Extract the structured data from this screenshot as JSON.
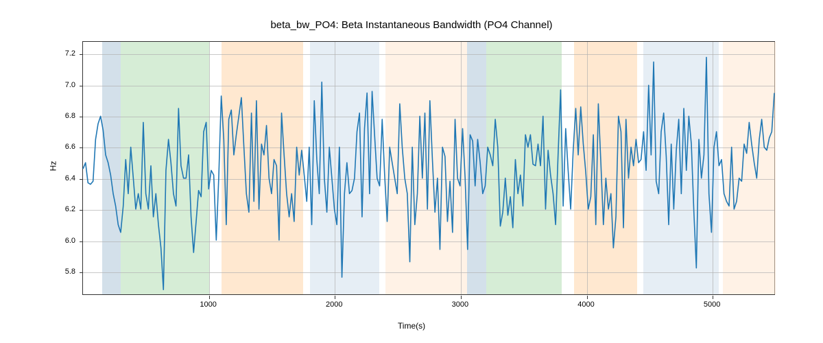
{
  "chart_data": {
    "type": "line",
    "title": "beta_bw_PO4: Beta Instantaneous Bandwidth (PO4 Channel)",
    "xlabel": "Time(s)",
    "ylabel": "Hz",
    "xlim": [
      0,
      5500
    ],
    "ylim": [
      5.65,
      7.28
    ],
    "xticks": [
      1000,
      2000,
      3000,
      4000,
      5000
    ],
    "yticks": [
      5.8,
      6.0,
      6.2,
      6.4,
      6.6,
      6.8,
      7.0,
      7.2
    ],
    "bands": [
      {
        "start": 150,
        "end": 300,
        "color": "#aec7d8",
        "opacity": 0.55
      },
      {
        "start": 300,
        "end": 1000,
        "color": "#b5dfb5",
        "opacity": 0.55
      },
      {
        "start": 1100,
        "end": 1750,
        "color": "#ffd8b1",
        "opacity": 0.6
      },
      {
        "start": 1800,
        "end": 2350,
        "color": "#d6e3ef",
        "opacity": 0.6
      },
      {
        "start": 2400,
        "end": 3050,
        "color": "#ffe8d1",
        "opacity": 0.55
      },
      {
        "start": 3050,
        "end": 3200,
        "color": "#aec7d8",
        "opacity": 0.55
      },
      {
        "start": 3200,
        "end": 3800,
        "color": "#b5dfb5",
        "opacity": 0.55
      },
      {
        "start": 3900,
        "end": 4400,
        "color": "#ffd8b1",
        "opacity": 0.6
      },
      {
        "start": 4450,
        "end": 5050,
        "color": "#d6e3ef",
        "opacity": 0.6
      },
      {
        "start": 5080,
        "end": 5500,
        "color": "#ffe8d1",
        "opacity": 0.55
      }
    ],
    "x": [
      0,
      20,
      40,
      60,
      80,
      100,
      120,
      140,
      160,
      180,
      200,
      220,
      240,
      260,
      280,
      300,
      320,
      340,
      360,
      380,
      400,
      420,
      440,
      460,
      480,
      500,
      520,
      540,
      560,
      580,
      600,
      620,
      640,
      660,
      680,
      700,
      720,
      740,
      760,
      780,
      800,
      820,
      840,
      860,
      880,
      900,
      920,
      940,
      960,
      980,
      1000,
      1020,
      1040,
      1060,
      1080,
      1100,
      1120,
      1140,
      1160,
      1180,
      1200,
      1220,
      1240,
      1260,
      1280,
      1300,
      1320,
      1340,
      1360,
      1380,
      1400,
      1420,
      1440,
      1460,
      1480,
      1500,
      1520,
      1540,
      1560,
      1580,
      1600,
      1620,
      1640,
      1660,
      1680,
      1700,
      1720,
      1740,
      1760,
      1780,
      1800,
      1820,
      1840,
      1860,
      1880,
      1900,
      1920,
      1940,
      1960,
      1980,
      2000,
      2020,
      2040,
      2060,
      2080,
      2100,
      2120,
      2140,
      2160,
      2180,
      2200,
      2220,
      2240,
      2260,
      2280,
      2300,
      2320,
      2340,
      2360,
      2380,
      2400,
      2420,
      2440,
      2460,
      2480,
      2500,
      2520,
      2540,
      2560,
      2580,
      2600,
      2620,
      2640,
      2660,
      2680,
      2700,
      2720,
      2740,
      2760,
      2780,
      2800,
      2820,
      2840,
      2860,
      2880,
      2900,
      2920,
      2940,
      2960,
      2980,
      3000,
      3020,
      3040,
      3060,
      3080,
      3100,
      3120,
      3140,
      3160,
      3180,
      3200,
      3220,
      3240,
      3260,
      3280,
      3300,
      3320,
      3340,
      3360,
      3380,
      3400,
      3420,
      3440,
      3460,
      3480,
      3500,
      3520,
      3540,
      3560,
      3580,
      3600,
      3620,
      3640,
      3660,
      3680,
      3700,
      3720,
      3740,
      3760,
      3780,
      3800,
      3820,
      3840,
      3860,
      3880,
      3900,
      3920,
      3940,
      3960,
      3980,
      4000,
      4020,
      4040,
      4060,
      4080,
      4100,
      4120,
      4140,
      4160,
      4180,
      4200,
      4220,
      4240,
      4260,
      4280,
      4300,
      4320,
      4340,
      4360,
      4380,
      4400,
      4420,
      4440,
      4460,
      4480,
      4500,
      4520,
      4540,
      4560,
      4580,
      4600,
      4620,
      4640,
      4660,
      4680,
      4700,
      4720,
      4740,
      4760,
      4780,
      4800,
      4820,
      4840,
      4860,
      4880,
      4900,
      4920,
      4940,
      4960,
      4980,
      5000,
      5020,
      5040,
      5060,
      5080,
      5100,
      5120,
      5140,
      5160,
      5180,
      5200,
      5220,
      5240,
      5260,
      5280,
      5300,
      5320,
      5340,
      5360,
      5380,
      5400,
      5420,
      5440,
      5460,
      5480,
      5500
    ],
    "values": [
      6.46,
      6.5,
      6.37,
      6.36,
      6.38,
      6.65,
      6.75,
      6.8,
      6.71,
      6.55,
      6.5,
      6.42,
      6.3,
      6.22,
      6.1,
      6.05,
      6.22,
      6.52,
      6.3,
      6.6,
      6.4,
      6.2,
      6.3,
      6.2,
      6.76,
      6.3,
      6.2,
      6.48,
      6.15,
      6.3,
      6.1,
      5.95,
      5.68,
      6.45,
      6.65,
      6.5,
      6.3,
      6.22,
      6.85,
      6.48,
      6.4,
      6.4,
      6.55,
      6.15,
      5.92,
      6.12,
      6.32,
      6.28,
      6.7,
      6.76,
      6.33,
      6.45,
      6.42,
      6.0,
      6.4,
      6.93,
      6.65,
      6.1,
      6.78,
      6.84,
      6.55,
      6.68,
      6.8,
      6.92,
      6.6,
      6.3,
      6.18,
      6.82,
      6.25,
      6.9,
      6.2,
      6.62,
      6.55,
      6.74,
      6.4,
      6.3,
      6.52,
      6.48,
      6.0,
      6.82,
      6.55,
      6.3,
      6.15,
      6.3,
      6.12,
      6.6,
      6.42,
      6.58,
      6.42,
      6.25,
      6.6,
      6.1,
      6.9,
      6.52,
      6.3,
      7.02,
      6.4,
      6.18,
      6.6,
      6.4,
      6.2,
      6.1,
      6.6,
      5.76,
      6.3,
      6.5,
      6.3,
      6.32,
      6.4,
      6.7,
      6.82,
      6.15,
      6.72,
      6.95,
      6.3,
      6.96,
      6.68,
      6.4,
      6.35,
      6.78,
      6.42,
      6.12,
      6.6,
      6.5,
      6.4,
      6.3,
      6.88,
      6.6,
      6.4,
      6.3,
      5.86,
      6.6,
      6.1,
      6.3,
      6.8,
      6.4,
      6.82,
      6.2,
      6.9,
      6.52,
      6.18,
      6.4,
      5.94,
      6.6,
      6.54,
      6.12,
      6.38,
      6.05,
      6.78,
      6.4,
      6.35,
      6.72,
      6.4,
      5.94,
      6.68,
      6.64,
      6.35,
      6.65,
      6.5,
      6.3,
      6.35,
      6.6,
      6.55,
      6.48,
      6.78,
      6.6,
      6.09,
      6.18,
      6.4,
      6.16,
      6.28,
      6.08,
      6.52,
      6.3,
      6.42,
      6.22,
      6.68,
      6.6,
      6.68,
      6.49,
      6.48,
      6.62,
      6.48,
      6.8,
      6.2,
      6.58,
      6.42,
      6.3,
      6.1,
      6.55,
      6.97,
      6.22,
      6.72,
      6.45,
      6.2,
      6.58,
      6.85,
      6.55,
      6.86,
      6.62,
      6.44,
      6.2,
      6.28,
      6.68,
      6.1,
      6.88,
      6.5,
      6.1,
      6.4,
      6.2,
      6.3,
      5.95,
      6.15,
      6.8,
      6.7,
      6.08,
      6.78,
      6.4,
      6.6,
      6.48,
      6.65,
      6.5,
      6.52,
      6.7,
      6.45,
      7.0,
      6.55,
      7.15,
      6.38,
      6.3,
      6.7,
      6.82,
      6.54,
      6.1,
      6.62,
      6.2,
      6.58,
      6.78,
      6.3,
      6.85,
      6.45,
      6.8,
      6.62,
      6.18,
      5.82,
      6.65,
      6.4,
      6.55,
      7.18,
      6.3,
      6.05,
      6.6,
      6.7,
      6.48,
      6.52,
      6.3,
      6.25,
      6.22,
      6.6,
      6.2,
      6.25,
      6.4,
      6.38,
      6.62,
      6.56,
      6.76,
      6.62,
      6.5,
      6.4,
      6.65,
      6.78,
      6.6,
      6.58,
      6.66,
      6.7,
      6.95
    ]
  }
}
